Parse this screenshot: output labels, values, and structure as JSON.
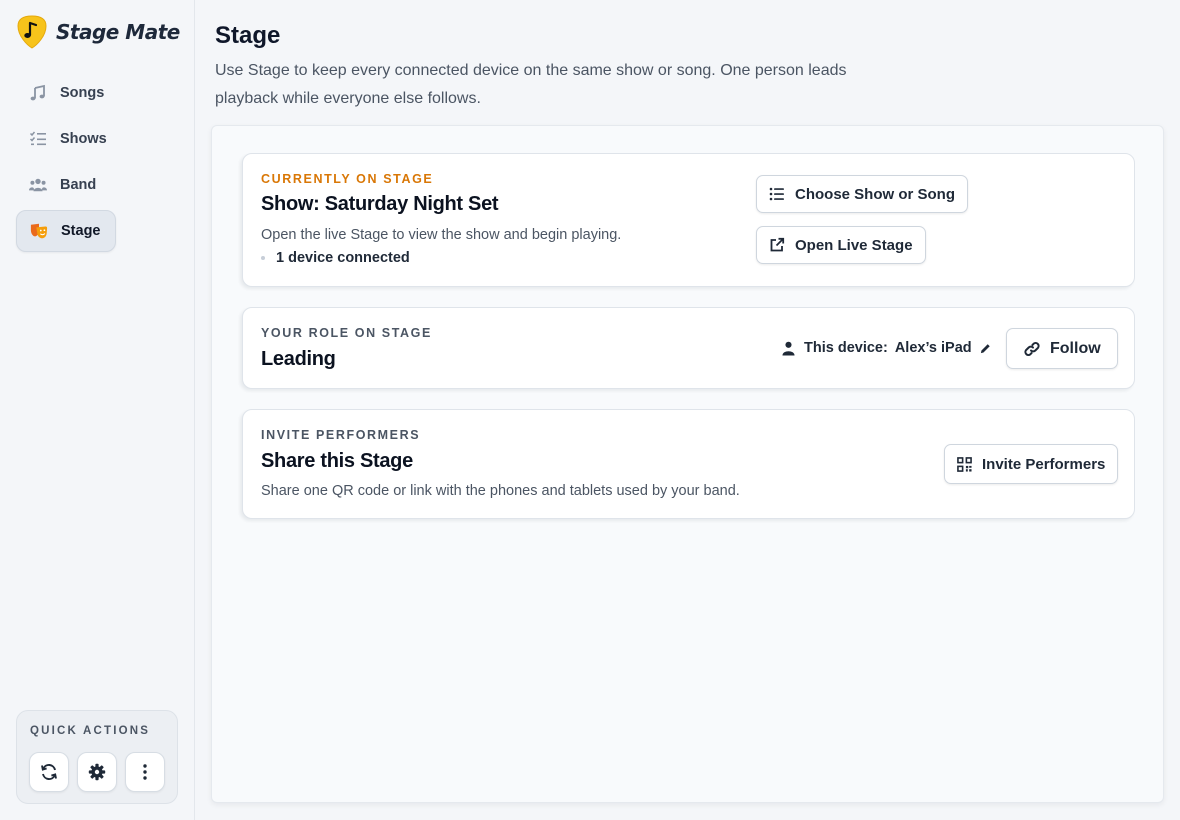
{
  "app": {
    "name": "Stage Mate"
  },
  "sidebar": {
    "items": [
      {
        "label": "Songs",
        "icon": "music-note-icon"
      },
      {
        "label": "Shows",
        "icon": "list-check-icon"
      },
      {
        "label": "Band",
        "icon": "users-icon"
      },
      {
        "label": "Stage",
        "icon": "theater-masks-icon",
        "active": true
      }
    ],
    "quick_actions": {
      "title": "QUICK ACTIONS",
      "buttons": [
        "refresh-icon",
        "gear-icon",
        "more-vertical-icon"
      ]
    }
  },
  "page": {
    "title": "Stage",
    "description": "Use Stage to keep every connected device on the same show or song. One person leads playback while everyone else follows."
  },
  "current": {
    "eyebrow": "CURRENTLY ON STAGE",
    "title": "Show: Saturday Night Set",
    "text": "Open the live Stage to view the show and begin playing.",
    "devices": "1 device connected",
    "choose_label": "Choose Show or Song",
    "open_label": "Open Live Stage"
  },
  "role": {
    "eyebrow": "YOUR ROLE ON STAGE",
    "title": "Leading",
    "device_prefix": "This device:",
    "device_name": "Alex’s iPad",
    "follow_label": "Follow"
  },
  "invite": {
    "eyebrow": "INVITE PERFORMERS",
    "title": "Share this Stage",
    "text": "Share one QR code or link with the phones and tablets used by your band.",
    "button_label": "Invite Performers"
  },
  "colors": {
    "accent": "#d97706",
    "logo": "#f7c31b"
  }
}
